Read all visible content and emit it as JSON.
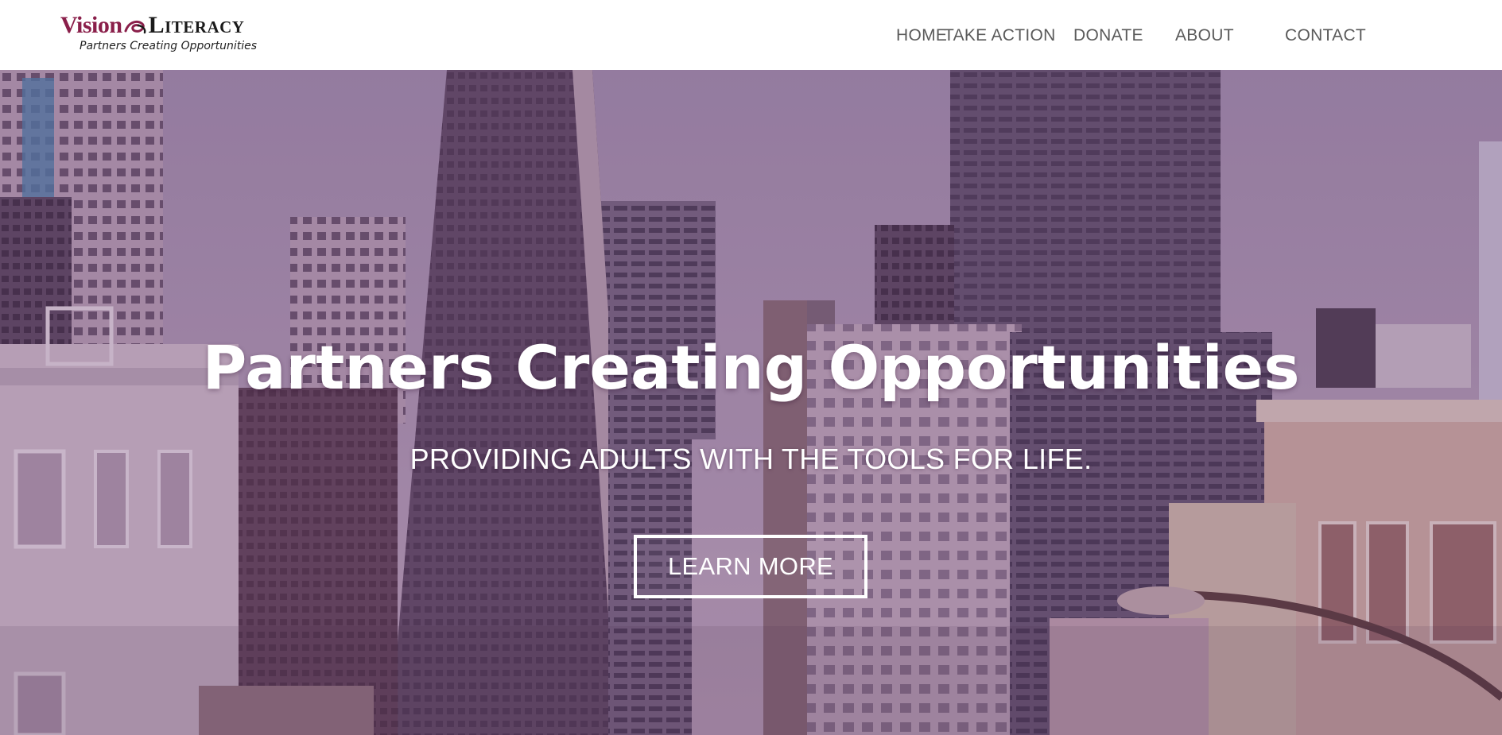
{
  "header": {
    "logo": {
      "word_left": "Vision",
      "word_right": "Literacy",
      "tagline": "Partners Creating Opportunities",
      "brand_color": "#8a1f4a"
    },
    "nav": [
      {
        "label": "HOME"
      },
      {
        "label": "TAKE ACTION"
      },
      {
        "label": "DONATE"
      },
      {
        "label": "ABOUT"
      },
      {
        "label": "CONTACT"
      }
    ]
  },
  "hero": {
    "title": "Partners Creating Opportunities",
    "subtitle": "PROVIDING ADULTS WITH THE TOOLS FOR LIFE.",
    "cta_label": "LEARN MORE",
    "overlay_tint": "#7d5c85",
    "background": "city-skyline-photo"
  }
}
